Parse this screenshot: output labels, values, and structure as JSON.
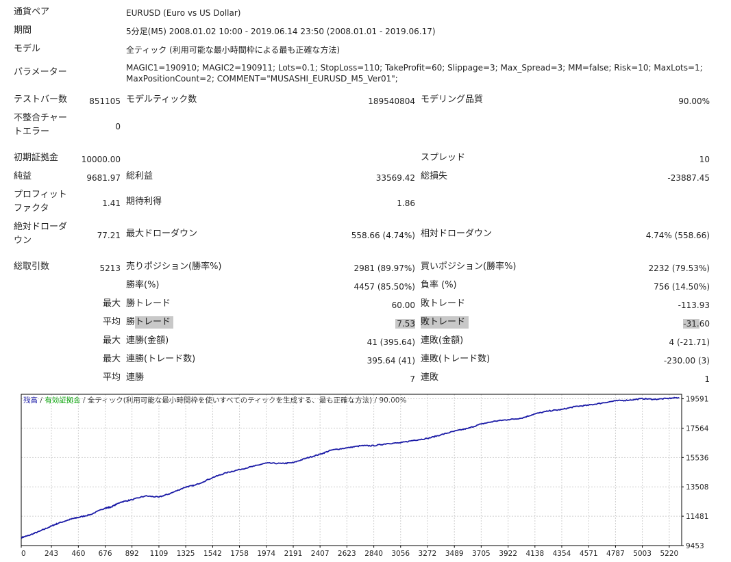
{
  "header": {
    "pair_label": "通貨ペア",
    "pair_value": "EURUSD (Euro vs US Dollar)",
    "period_label": "期間",
    "period_value": "5分足(M5) 2008.01.02 10:00 - 2019.06.14 23:50 (2008.01.01 - 2019.06.17)",
    "model_label": "モデル",
    "model_value": "全ティック (利用可能な最小時間枠による最も正確な方法)",
    "params_label": "パラメーター",
    "params_line1": "MAGIC1=190910; MAGIC2=190911; Lots=0.1; StopLoss=110; TakeProfit=60; Slippage=3; Max_Spread=3; MM=false; Risk=10; MaxLots=1;",
    "params_line2": "MaxPositionCount=2; COMMENT=\"MUSASHI_EURUSD_M5_Ver01\";"
  },
  "stats": {
    "bars_label": "テストバー数",
    "bars_value": "851105",
    "ticks_label": "モデルティック数",
    "ticks_value": "189540804",
    "quality_label": "モデリング品質",
    "quality_value": "90.00%",
    "mismatch_label_1": "不整合チャー",
    "mismatch_label_2": "トエラー",
    "mismatch_value": "0",
    "deposit_label": "初期証拠金",
    "deposit_value": "10000.00",
    "spread_label": "スプレッド",
    "spread_value": "10",
    "net_label": "純益",
    "net_value": "9681.97",
    "gross_profit_label": "総利益",
    "gross_profit_value": "33569.42",
    "gross_loss_label": "総損失",
    "gross_loss_value": "-23887.45",
    "pf_label_1": "プロフィット",
    "pf_label_2": "ファクタ",
    "pf_value": "1.41",
    "expected_label": "期待利得",
    "expected_value": "1.86",
    "abs_dd_label_1": "絶対ドローダ",
    "abs_dd_label_2": "ウン",
    "abs_dd_value": "77.21",
    "max_dd_label": "最大ドローダウン",
    "max_dd_value": "558.66 (4.74%)",
    "rel_dd_label": "相対ドローダウン",
    "rel_dd_value": "4.74% (558.66)",
    "trades_label": "総取引数",
    "trades_value": "5213",
    "short_label": "売りポジション(勝率%)",
    "short_value": "2981 (89.97%)",
    "long_label": "買いポジション(勝率%)",
    "long_value": "2232 (79.53%)",
    "win_rate_label": "勝率(%)",
    "win_rate_value": "4457 (85.50%)",
    "loss_rate_label": "負率 (%)",
    "loss_rate_value": "756 (14.50%)",
    "max_label": "最大",
    "avg_label": "平均",
    "win_trade_label": "勝トレード",
    "lose_trade_label": "敗トレード",
    "largest_win_value": "60.00",
    "largest_loss_value": "-113.93",
    "avg_win_prefix": "勝",
    "avg_win_hl": "トレード",
    "avg_win_value": "7.53",
    "avg_loss_hl": "敗トレード",
    "avg_loss_value_hl": "-31.",
    "avg_loss_value_rest": "60",
    "consec_wins_amount_label": "連勝(金額)",
    "consec_wins_amount_value": "41 (395.64)",
    "consec_losses_amount_label": "連敗(金額)",
    "consec_losses_amount_value": "4 (-21.71)",
    "consec_wins_count_label": "連勝(トレード数)",
    "consec_wins_count_value": "395.64 (41)",
    "consec_losses_count_label": "連敗(トレード数)",
    "consec_losses_count_value": "-230.00 (3)",
    "avg_consec_wins_label": "連勝",
    "avg_consec_wins_value": "7",
    "avg_consec_losses_label": "連敗",
    "avg_consec_losses_value": "1"
  },
  "chart_data": {
    "type": "line",
    "legend_balance": "残高",
    "legend_sep": " / ",
    "legend_equity": "有効証拠金",
    "legend_rest": " / 全ティック(利用可能な最小時間枠を使いすべてのティックを生成する、最も正確な方法) / 90.00%",
    "colors": {
      "balance": "#1a1aa6",
      "equity": "#00a000",
      "text": "#333333",
      "grid": "#cfcfcf"
    },
    "x_ticks": [
      0,
      243,
      460,
      676,
      892,
      1109,
      1325,
      1542,
      1758,
      1974,
      2191,
      2407,
      2623,
      2840,
      3056,
      3272,
      3489,
      3705,
      3922,
      4138,
      4354,
      4571,
      4787,
      5003,
      5220
    ],
    "y_ticks": [
      9453,
      11481,
      13508,
      15536,
      17564,
      19591
    ],
    "xlim": [
      0,
      5320
    ],
    "ylim": [
      9453,
      19900
    ],
    "x": [
      0,
      60,
      150,
      243,
      300,
      400,
      460,
      560,
      676,
      720,
      800,
      892,
      1000,
      1109,
      1200,
      1325,
      1400,
      1542,
      1650,
      1758,
      1880,
      1974,
      2100,
      2191,
      2300,
      2407,
      2500,
      2623,
      2740,
      2840,
      2950,
      3056,
      3160,
      3272,
      3380,
      3489,
      3600,
      3705,
      3820,
      3922,
      4030,
      4138,
      4250,
      4354,
      4460,
      4571,
      4680,
      4787,
      4900,
      5003,
      5100,
      5220,
      5300
    ],
    "y": [
      10000,
      10150,
      10450,
      10800,
      11000,
      11280,
      11400,
      11600,
      12050,
      12100,
      12450,
      12620,
      12880,
      12800,
      13050,
      13500,
      13620,
      14150,
      14480,
      14700,
      14950,
      15150,
      15120,
      15180,
      15500,
      15760,
      16050,
      16200,
      16350,
      16350,
      16500,
      16550,
      16720,
      16850,
      17100,
      17350,
      17550,
      17850,
      18050,
      18150,
      18250,
      18550,
      18750,
      18850,
      19050,
      19150,
      19300,
      19450,
      19500,
      19600,
      19550,
      19620,
      19680
    ]
  }
}
